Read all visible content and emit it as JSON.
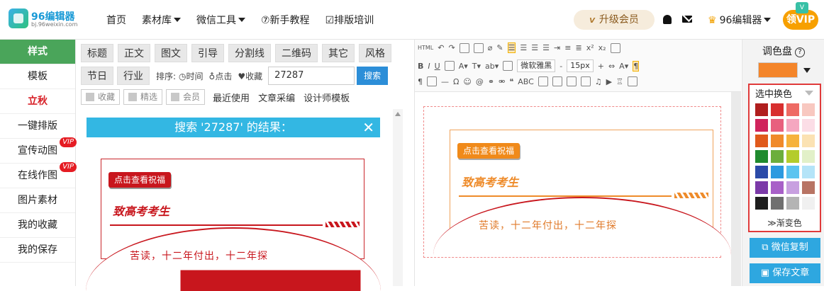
{
  "logo": {
    "name": "96编辑器",
    "url": "bj.96weixin.com"
  },
  "nav": [
    {
      "label": "首页"
    },
    {
      "label": "素材库"
    },
    {
      "label": "微信工具"
    },
    {
      "label": "⑦新手教程"
    },
    {
      "label": "☑排版培训"
    }
  ],
  "header": {
    "upgrade_label": "升级会员",
    "user_name": "96编辑器",
    "vip_btn": "领VIP",
    "vip_badge": "V"
  },
  "sidebar": {
    "items": [
      {
        "label": "样式",
        "vip": ""
      },
      {
        "label": "模板",
        "vip": ""
      },
      {
        "label": "立秋",
        "vip": ""
      },
      {
        "label": "一键排版",
        "vip": ""
      },
      {
        "label": "宣传动图",
        "vip": "VIP"
      },
      {
        "label": "在线作图",
        "vip": "VIP"
      },
      {
        "label": "图片素材",
        "vip": ""
      },
      {
        "label": "我的收藏",
        "vip": ""
      },
      {
        "label": "我的保存",
        "vip": ""
      }
    ]
  },
  "panel": {
    "tabs_row1": [
      "标题",
      "正文",
      "图文",
      "引导",
      "分割线",
      "二维码",
      "其它",
      "风格"
    ],
    "tabs_row2": [
      "节日",
      "行业"
    ],
    "sort_label": "排序:",
    "sort_options": [
      "◷时间",
      "♁点击",
      "♥收藏"
    ],
    "search_value": "27287",
    "search_btn": "搜索",
    "filters": [
      "收藏",
      "精选",
      "会员"
    ],
    "links": [
      "最近使用",
      "文章采编",
      "设计师模板"
    ],
    "result_title": "搜索 '27287' 的结果：",
    "close": "✕",
    "tpl_btn": "点击查看祝福",
    "tpl_title": "致高考考生",
    "tpl_text": "苦读，十二年付出，十二年探"
  },
  "editor": {
    "font_select": "微软雅黑",
    "font_size": "15px",
    "html_label": "HTML",
    "card_btn": "点击查看祝福",
    "card_title": "致高考考生",
    "card_text": "苦读，十二年付出，十二年探"
  },
  "palette": {
    "title": "调色盘",
    "help": "?",
    "current_color": "#f4852a",
    "mode": "选中换色",
    "gradient": "≫渐变色",
    "colors": [
      "#b01e1e",
      "#d82f2f",
      "#ee6a64",
      "#f8c8c0",
      "#d0245c",
      "#e8607e",
      "#f5a7c0",
      "#fbdde6",
      "#e05a1c",
      "#f08a2a",
      "#f6b23c",
      "#fbe2b3",
      "#1f8a2e",
      "#6cae3c",
      "#b4cc2c",
      "#e2f0c8",
      "#2b4aa8",
      "#2c9ae0",
      "#5cc4f0",
      "#b4e4f8",
      "#7b3aa8",
      "#a860c8",
      "#c8a0e0",
      "#b87464",
      "#1e1e1e",
      "#707070",
      "#b4b4b4",
      "#f0f0f0"
    ],
    "copy_btn": "微信复制",
    "save_btn": "保存文章"
  }
}
